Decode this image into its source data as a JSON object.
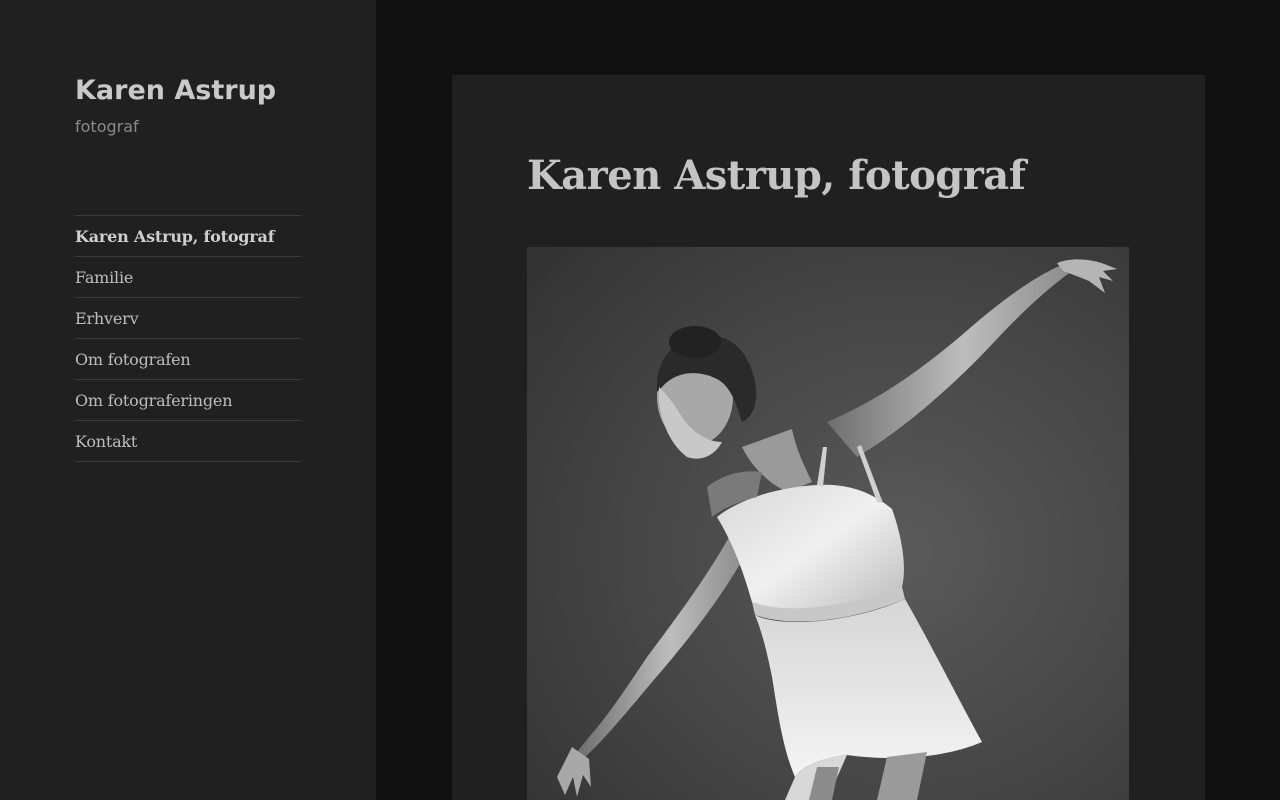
{
  "site": {
    "title": "Karen Astrup",
    "description": "fotograf"
  },
  "nav": {
    "items": [
      {
        "label": "Karen Astrup, fotograf",
        "current": true
      },
      {
        "label": "Familie"
      },
      {
        "label": "Erhverv"
      },
      {
        "label": "Om fotografen"
      },
      {
        "label": "Om fotograferingen"
      },
      {
        "label": "Kontakt"
      }
    ]
  },
  "main": {
    "title": "Karen Astrup, fotograf",
    "image": {
      "subject": "black-and-white photograph of a ballet dancer"
    }
  },
  "colors": {
    "page_background": "#111111",
    "panel_background": "#202020",
    "title_text": "#c4c4c4",
    "nav_text": "#bdbdbd",
    "divider": "#3a3a3a"
  }
}
